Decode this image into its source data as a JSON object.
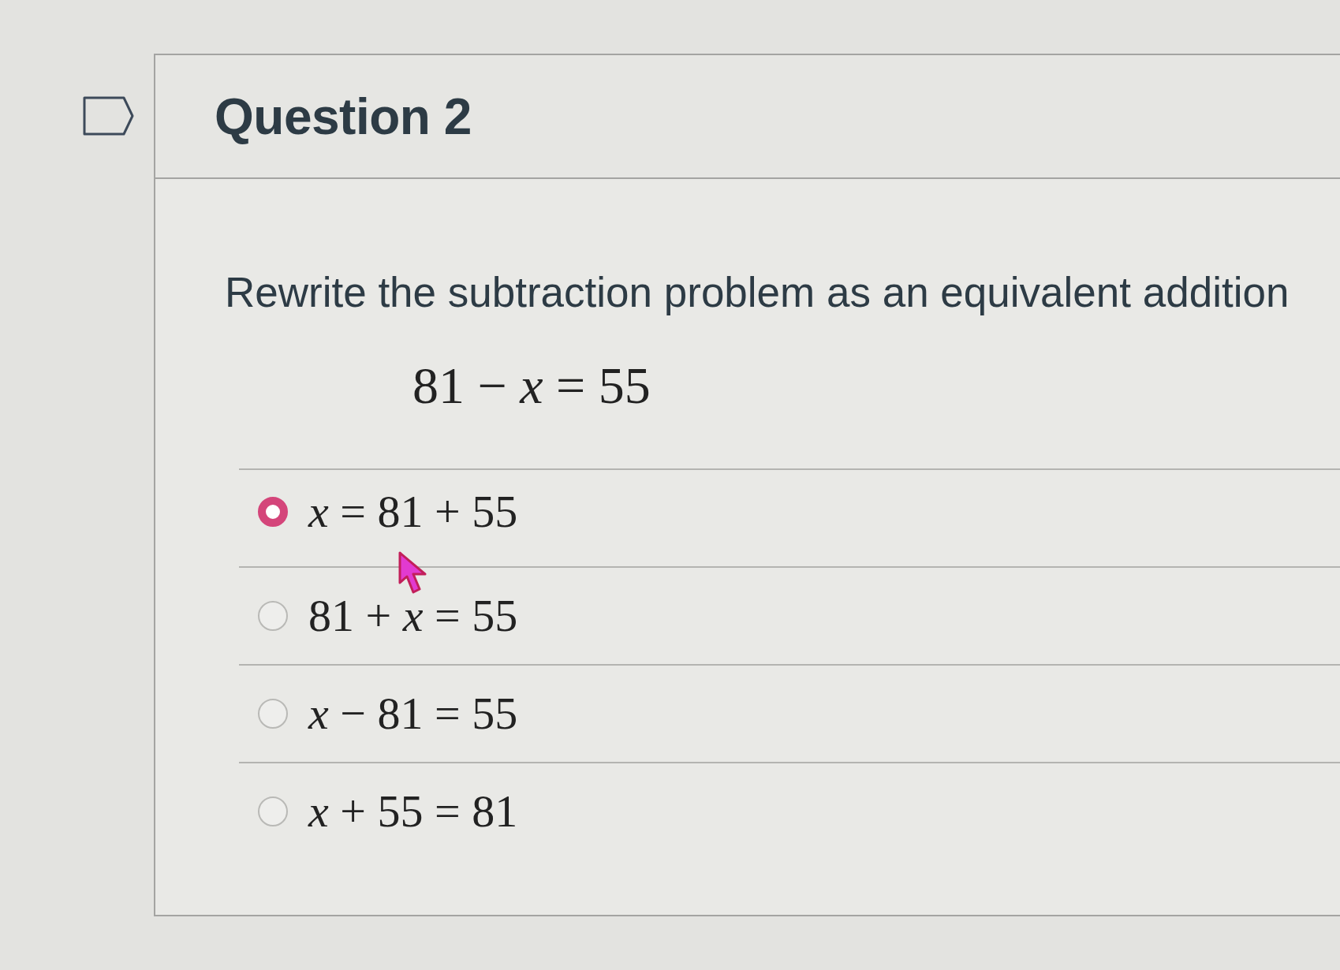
{
  "question": {
    "title": "Question 2",
    "flagged": false
  },
  "prompt": "Rewrite the subtraction problem as an equivalent addition",
  "equation": "81 − *x* = 55",
  "options": [
    {
      "label": "*x* = 81 + 55",
      "selected": true
    },
    {
      "label": "81 + *x* = 55",
      "selected": false
    },
    {
      "label": "*x* − 81 = 55",
      "selected": false
    },
    {
      "label": "*x* + 55 = 81",
      "selected": false
    }
  ]
}
